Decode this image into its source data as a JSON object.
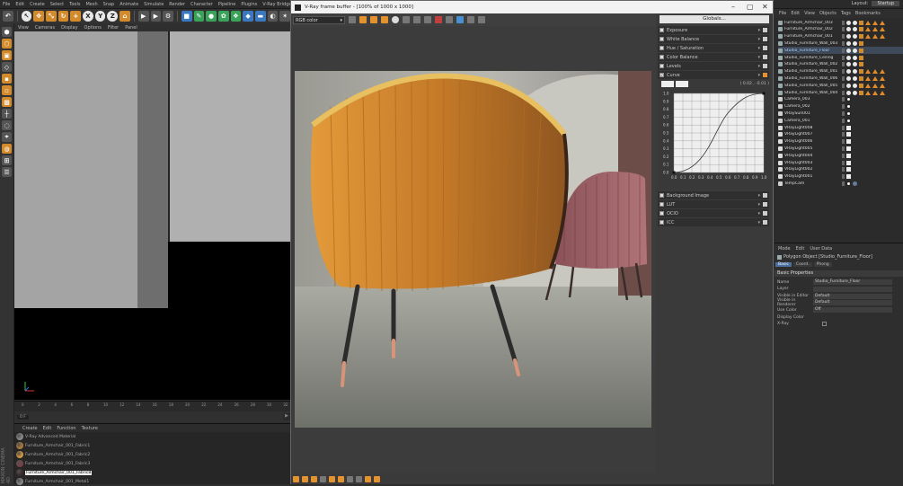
{
  "menubar": {
    "items": [
      "File",
      "Edit",
      "Create",
      "Select",
      "Tools",
      "Mesh",
      "Snap",
      "Animate",
      "Simulate",
      "Render",
      "Character",
      "Pipeline",
      "Plugins",
      "V-Ray Bridge",
      "3DToAll",
      "Script",
      "Window",
      "Help"
    ],
    "layout_label": "Layout:",
    "layout_value": "Startup"
  },
  "viewport": {
    "menu": [
      "View",
      "Cameras",
      "Display",
      "Options",
      "Filter",
      "Panel"
    ]
  },
  "timeline": {
    "ticks": [
      "0",
      "2",
      "4",
      "6",
      "8",
      "10",
      "12",
      "14",
      "16",
      "18",
      "20",
      "22",
      "24",
      "26",
      "28",
      "30",
      "32"
    ],
    "frame_field": "0 F"
  },
  "material_manager": {
    "menu": [
      "Create",
      "Edit",
      "Function",
      "Texture"
    ],
    "materials": [
      {
        "name": "V-Ray Advanced Material",
        "color": "#8a8a8a"
      },
      {
        "name": "Furniture_Armchair_001_Fabric1",
        "color": "#b07a3a"
      },
      {
        "name": "Furniture_Armchair_001_Fabric2",
        "color": "#d89a40"
      },
      {
        "name": "Furniture_Armchair_001_Fabric3",
        "color": "#7a4048"
      },
      {
        "name": "Furniture_Armchair_001_Fabric8",
        "color": "#3a2a2a"
      },
      {
        "name": "Furniture_Armchair_001_Metal1",
        "color": "#888"
      }
    ],
    "brand": "MAXON CINEMA 4D"
  },
  "vfb": {
    "title": "V-Ray frame buffer - [100% of 1000 x 1000]",
    "channel": "RGB color",
    "globals_label": "Globals...",
    "corrections": [
      {
        "label": "Exposure",
        "checked": false
      },
      {
        "label": "White Balance",
        "checked": false
      },
      {
        "label": "Hue / Saturation",
        "checked": false
      },
      {
        "label": "Color Balance",
        "checked": false
      },
      {
        "label": "Levels",
        "checked": false
      },
      {
        "label": "Curve",
        "checked": true
      }
    ],
    "curve": {
      "coord": "( 0.02 , -0.01 )",
      "x_ticks": [
        "0.0",
        "0.1",
        "0.2",
        "0.3",
        "0.4",
        "0.5",
        "0.6",
        "0.7",
        "0.8",
        "0.9",
        "1.0"
      ],
      "y_ticks": [
        "1.0",
        "0.9",
        "0.8",
        "0.7",
        "0.6",
        "0.5",
        "0.4",
        "0.3",
        "0.2",
        "0.1",
        "0.0"
      ]
    },
    "extra_corrections": [
      {
        "label": "Background Image"
      },
      {
        "label": "LUT"
      },
      {
        "label": "OCIO"
      },
      {
        "label": "ICC"
      }
    ]
  },
  "object_manager": {
    "menu": [
      "File",
      "Edit",
      "View",
      "Objects",
      "Tags",
      "Bookmarks"
    ],
    "objects": [
      {
        "name": "Furniture_Armchair_003",
        "tags": "mat"
      },
      {
        "name": "Furniture_Armchair_002",
        "tags": "mat"
      },
      {
        "name": "Furniture_Armchair_001",
        "tags": "mat"
      },
      {
        "name": "Studio_Furniture_Wall_003",
        "tags": "mat"
      },
      {
        "name": "Studio_Furniture_Floor",
        "tags": "mat",
        "selected": true
      },
      {
        "name": "Studio_Furniture_Ceiling",
        "tags": "mat"
      },
      {
        "name": "Studio_Furniture_Wall_002",
        "tags": "mat"
      },
      {
        "name": "Studio_Furniture_Wall_001",
        "tags": "mat"
      },
      {
        "name": "Studio_Furniture_Wall_006",
        "tags": "mat"
      },
      {
        "name": "Studio_Furniture_Wall_005",
        "tags": "mat"
      },
      {
        "name": "Studio_Furniture_Wall_004",
        "tags": "mat"
      },
      {
        "name": "Camera_003",
        "tags": "cam"
      },
      {
        "name": "Camera_002",
        "tags": "cam"
      },
      {
        "name": "VRaySun001",
        "tags": "cam"
      },
      {
        "name": "Camera_001",
        "tags": "cam"
      },
      {
        "name": "VRayLight008",
        "tags": "light"
      },
      {
        "name": "VRayLight007",
        "tags": "light"
      },
      {
        "name": "VRayLight006",
        "tags": "light"
      },
      {
        "name": "VRayLight005",
        "tags": "light"
      },
      {
        "name": "VRayLight004",
        "tags": "light"
      },
      {
        "name": "VRayLight003",
        "tags": "light"
      },
      {
        "name": "VRayLight002",
        "tags": "light"
      },
      {
        "name": "VRayLight001",
        "tags": "light"
      },
      {
        "name": "TempCam",
        "tags": "cam"
      }
    ]
  },
  "attribute_manager": {
    "menu": [
      "Mode",
      "Edit",
      "User Data"
    ],
    "object_title": "Polygon Object [Studio_Furniture_Floor]",
    "tabs": [
      {
        "label": "Basic",
        "active": true
      },
      {
        "label": "Coord.",
        "active": false
      },
      {
        "label": "Phong",
        "active": false
      }
    ],
    "section": "Basic Properties",
    "props": [
      {
        "label": "Name",
        "value": "Studio_Furniture_Floor"
      },
      {
        "label": "Layer",
        "value": ""
      },
      {
        "label": "Visible in Editor",
        "value": "Default"
      },
      {
        "label": "Visible in Renderer",
        "value": "Default"
      },
      {
        "label": "Use Color",
        "value": "Off"
      },
      {
        "label": "Display Color",
        "value": ""
      },
      {
        "label": "X-Ray",
        "value": ""
      }
    ]
  }
}
